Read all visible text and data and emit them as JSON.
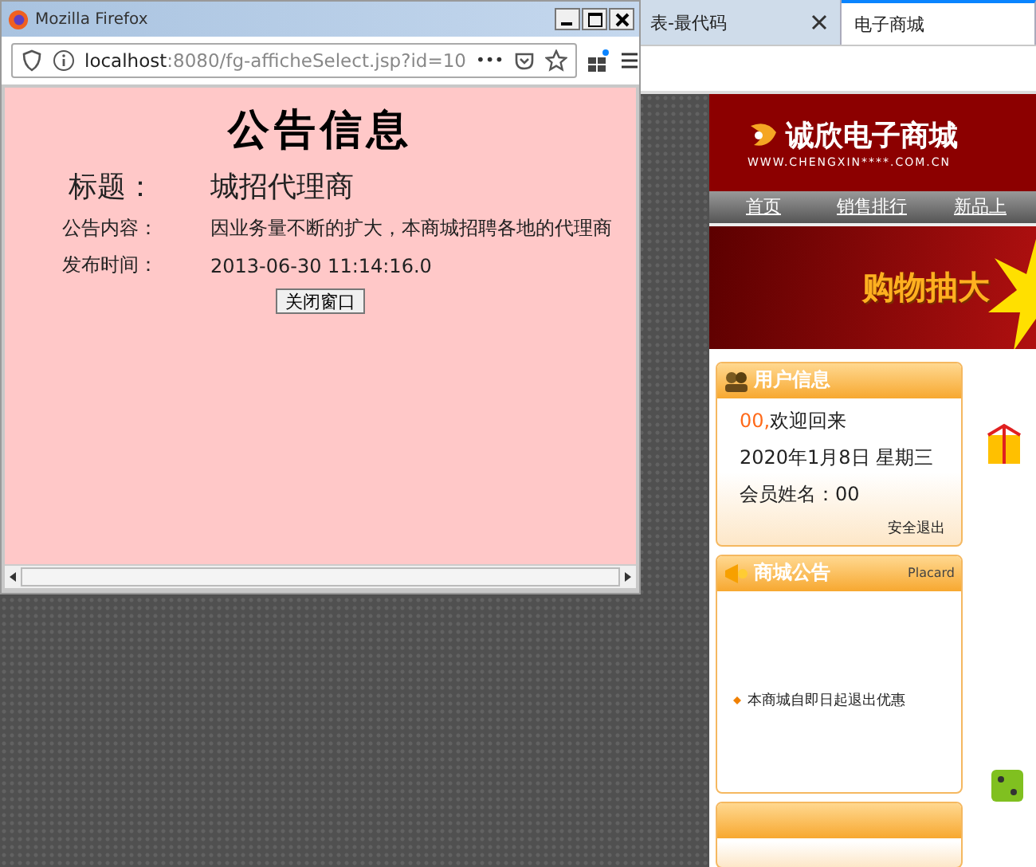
{
  "background_browser": {
    "tabs": [
      {
        "label": "表-最代码",
        "selected": false,
        "closable": true
      },
      {
        "label": "电子商城",
        "selected": true,
        "closable": false
      }
    ]
  },
  "site": {
    "logo": {
      "name": "诚欣电子商城",
      "url": "WWW.CHENGXIN****.COM.CN"
    },
    "nav": [
      "首页",
      "销售排行",
      "新品上"
    ],
    "banner": {
      "text": "购物抽大"
    },
    "user_panel": {
      "title": "用户信息",
      "greeting_name": "00,",
      "greeting": "欢迎回来",
      "date": "2020年1月8日 星期三",
      "member": "会员姓名：00",
      "logout": "安全退出"
    },
    "notice_panel": {
      "title": "商城公告",
      "subtitle": "Placard",
      "items": [
        "本商城自即日起退出优惠"
      ]
    }
  },
  "popup": {
    "title": "Mozilla Firefox",
    "url_host": "localhost",
    "url_rest": ":8080/fg-afficheSelect.jsp?id=10",
    "more": "•••",
    "heading": "公告信息",
    "rows": [
      {
        "label": "标题：",
        "value": "城招代理商",
        "kind": "large"
      },
      {
        "label": "公告内容：",
        "value": "因业务量不断的扩大，本商城招聘各地的代理商",
        "kind": "normal"
      },
      {
        "label": "发布时间：",
        "value": "2013-06-30 11:14:16.0",
        "kind": "normal"
      }
    ],
    "button": "关闭窗口"
  }
}
